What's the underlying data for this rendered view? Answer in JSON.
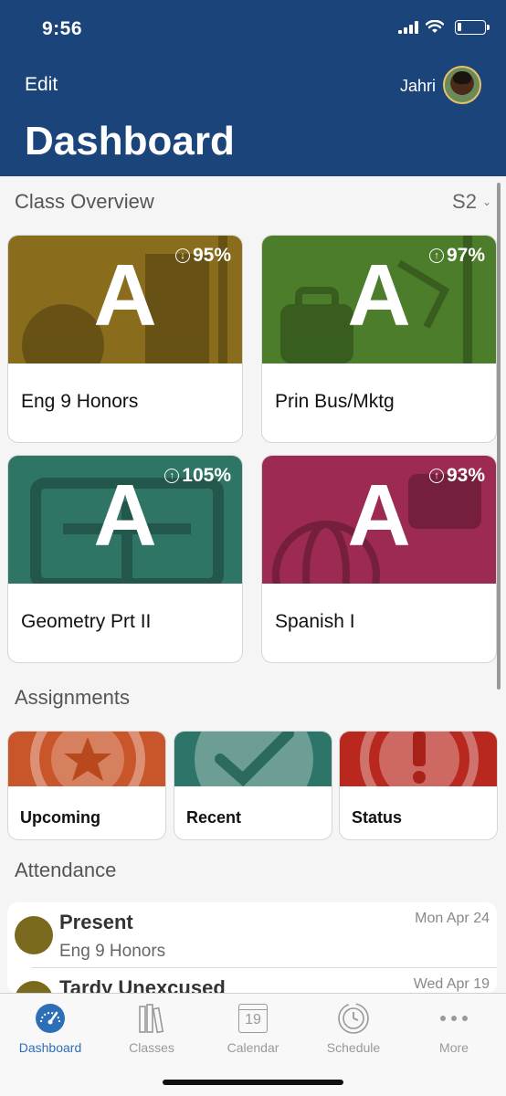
{
  "status_bar": {
    "time": "9:56"
  },
  "header": {
    "edit_label": "Edit",
    "user_name": "Jahri",
    "title": "Dashboard"
  },
  "class_overview": {
    "heading": "Class Overview",
    "term": "S2",
    "classes": [
      {
        "name": "Eng 9 Honors",
        "grade": "A",
        "percent": "95%",
        "trend": "down",
        "color": "#8a6d1c"
      },
      {
        "name": "Prin Bus/Mktg",
        "grade": "A",
        "percent": "97%",
        "trend": "up",
        "color": "#4b7d2a"
      },
      {
        "name": "Geometry Prt II",
        "grade": "A",
        "percent": "105%",
        "trend": "up",
        "color": "#2f7565"
      },
      {
        "name": "Spanish I",
        "grade": "A",
        "percent": "93%",
        "trend": "up",
        "color": "#9c2a52"
      }
    ]
  },
  "assignments": {
    "heading": "Assignments",
    "cards": [
      {
        "label": "Upcoming",
        "icon": "star-icon",
        "color": "#c9562a"
      },
      {
        "label": "Recent",
        "icon": "checkmark-icon",
        "color": "#2d7568"
      },
      {
        "label": "Status",
        "icon": "exclamation-icon",
        "color": "#b8281f"
      }
    ]
  },
  "attendance": {
    "heading": "Attendance",
    "entries": [
      {
        "status": "Present",
        "class": "Eng 9 Honors",
        "date": "Mon Apr 24"
      },
      {
        "status": "Tardy Unexcused",
        "date": "Wed Apr 19"
      }
    ]
  },
  "tabbar": {
    "tabs": [
      {
        "label": "Dashboard",
        "icon": "gauge-icon",
        "active": true
      },
      {
        "label": "Classes",
        "icon": "books-icon"
      },
      {
        "label": "Calendar",
        "icon": "calendar-icon",
        "calendar_day": "19"
      },
      {
        "label": "Schedule",
        "icon": "clock-icon"
      },
      {
        "label": "More",
        "icon": "more-dots-icon"
      }
    ]
  }
}
